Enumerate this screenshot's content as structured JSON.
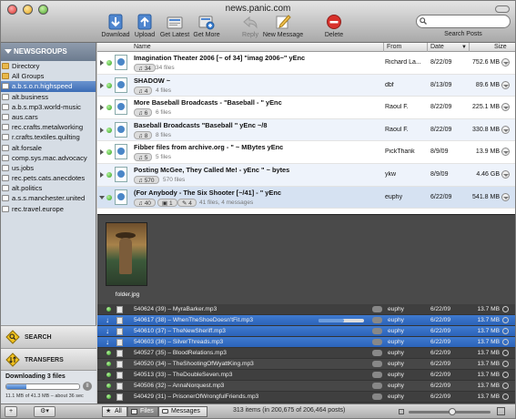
{
  "window": {
    "title": "news.panic.com"
  },
  "toolbar": {
    "download": "Download",
    "upload": "Upload",
    "get_latest": "Get Latest",
    "get_more": "Get More",
    "reply": "Reply",
    "new_message": "New Message",
    "delete": "Delete",
    "search_placeholder": "",
    "search_label": "Search Posts"
  },
  "sidebar": {
    "header": "NEWSGROUPS",
    "items": [
      {
        "label": "Directory",
        "kind": "folder"
      },
      {
        "label": "All Groups",
        "kind": "folder"
      },
      {
        "label": "a.b.s.o.n.highspeed",
        "kind": "group",
        "selected": true
      },
      {
        "label": "alt.business",
        "kind": "group"
      },
      {
        "label": "a.b.s.mp3.world-music",
        "kind": "group"
      },
      {
        "label": "aus.cars",
        "kind": "group"
      },
      {
        "label": "rec.crafts.metalworking",
        "kind": "group"
      },
      {
        "label": "r.crafts.textiles.quilting",
        "kind": "group"
      },
      {
        "label": "alt.forsale",
        "kind": "group"
      },
      {
        "label": "comp.sys.mac.advocacy",
        "kind": "group"
      },
      {
        "label": "us.jobs",
        "kind": "group"
      },
      {
        "label": "rec.pets.cats.anecdotes",
        "kind": "group"
      },
      {
        "label": "alt.politics",
        "kind": "group"
      },
      {
        "label": "a.s.s.manchester.united",
        "kind": "group"
      },
      {
        "label": "rec.travel.europe",
        "kind": "group"
      }
    ],
    "search_label": "SEARCH",
    "transfers_label": "TRANSFERS",
    "download_title": "Downloading 3 files",
    "download_progress": 0.27,
    "download_status": "11.1 MB of 41.3 MB – about 36 sec"
  },
  "columns": {
    "name": "Name",
    "from": "From",
    "date": "Date",
    "size": "Size"
  },
  "posts": [
    {
      "title": "Imagination Theater 2006 [~ of 34] \"imag 2006~\" yEnc",
      "count": "34",
      "extra": "34 files",
      "from": "Richard La...",
      "date": "8/22/09",
      "size": "752.6 MB"
    },
    {
      "title": "SHADOW ~",
      "count": "4",
      "extra": "4 files",
      "from": "dbf",
      "date": "8/13/09",
      "size": "89.6 MB"
    },
    {
      "title": "More Baseball Broadcasts - \"Baseball - \" yEnc",
      "count": "6",
      "extra": "6 files",
      "from": "Raoul F.",
      "date": "8/22/09",
      "size": "225.1 MB"
    },
    {
      "title": "Baseball Broadcasts \"Baseball \" yEnc ~/8",
      "count": "8",
      "extra": "8 files",
      "from": "Raoul F.",
      "date": "8/22/09",
      "size": "330.8 MB"
    },
    {
      "title": "Fibber files from archive.org - \" ~ MBytes yEnc",
      "count": "5",
      "extra": "5 files",
      "from": "PickThank",
      "date": "8/9/09",
      "size": "13.9 MB"
    },
    {
      "title": "Posting McGee, They Called Me! - yEnc \" ~ bytes",
      "count": "570",
      "extra": "570 files",
      "from": "ykw",
      "date": "8/9/09",
      "size": "4.46 GB"
    },
    {
      "title": "(For Anybody - The Six Shooter [~/41] - \" yEnc",
      "count": "40",
      "extra": "1",
      "extra2": "4",
      "extra3": "41 files, 4 messages",
      "from": "euphy",
      "date": "6/22/09",
      "size": "541.8 MB"
    }
  ],
  "preview": {
    "image_label": "folder.jpg"
  },
  "files": [
    {
      "name": "540624 (39) – MyraBarker.mp3",
      "from": "euphy",
      "date": "6/22/09",
      "size": "13.7 MB",
      "state": "done"
    },
    {
      "name": "540617 (38) – WhenTheShoeDoesn'tFit.mp3",
      "from": "euphy",
      "date": "6/22/09",
      "size": "13.7 MB",
      "state": "downloading",
      "progress": 0.55
    },
    {
      "name": "540610 (37) – TheNewSheriff.mp3",
      "from": "euphy",
      "date": "6/22/09",
      "size": "13.7 MB",
      "state": "queued"
    },
    {
      "name": "540603 (36) – SilverThreads.mp3",
      "from": "euphy",
      "date": "6/22/09",
      "size": "13.7 MB",
      "state": "queued"
    },
    {
      "name": "540527 (35) – BloodRelations.mp3",
      "from": "euphy",
      "date": "6/22/09",
      "size": "13.7 MB",
      "state": "done"
    },
    {
      "name": "540520 (34) – TheShootingOfWyattKing.mp3",
      "from": "euphy",
      "date": "6/22/09",
      "size": "13.7 MB",
      "state": "done"
    },
    {
      "name": "540513 (33) – TheDoubleSeven.mp3",
      "from": "euphy",
      "date": "6/22/09",
      "size": "13.7 MB",
      "state": "done"
    },
    {
      "name": "540506 (32) – AnnaNorquest.mp3",
      "from": "euphy",
      "date": "6/22/09",
      "size": "13.7 MB",
      "state": "done"
    },
    {
      "name": "540429 (31) – PrisonerOfWrongfulFriends.mp3",
      "from": "euphy",
      "date": "6/22/09",
      "size": "13.7 MB",
      "state": "done"
    }
  ],
  "bottombar": {
    "all": "All",
    "files": "Files",
    "messages": "Messages",
    "status": "313 items (in 200,675 of 206,464 posts)"
  },
  "colors": {
    "selection": "#3c6cb5",
    "unread_dot": "#2e9d1d",
    "delete_red": "#d8312b"
  }
}
